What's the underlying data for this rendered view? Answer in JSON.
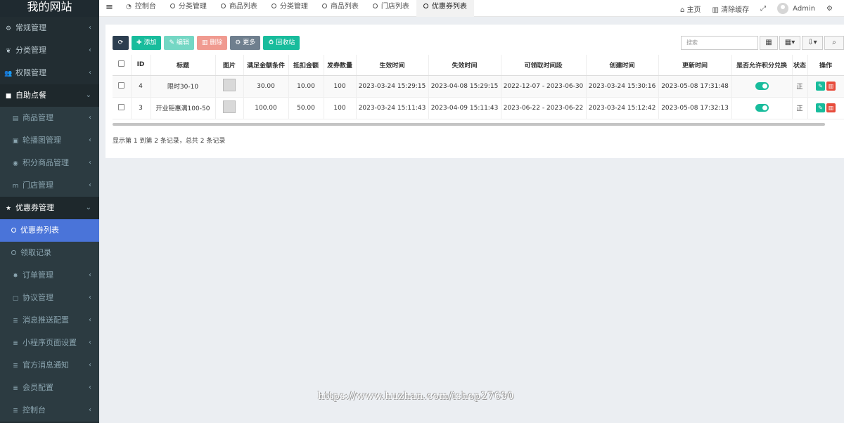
{
  "sidebar": {
    "logo": "我的网站",
    "items": [
      {
        "label": "常规管理",
        "icon": "cogs-icon",
        "glyph": "⚙",
        "type": "group"
      },
      {
        "label": "分类管理",
        "icon": "leaf-icon",
        "glyph": "❦",
        "type": "top"
      },
      {
        "label": "权限管理",
        "icon": "group-icon",
        "glyph": "👥",
        "type": "group"
      },
      {
        "label": "自助点餐",
        "icon": "cutlery-icon",
        "glyph": "■",
        "type": "open"
      },
      {
        "label": "商品管理",
        "icon": "goods-icon",
        "glyph": "▤",
        "type": "sub"
      },
      {
        "label": "轮播图管理",
        "icon": "image-icon",
        "glyph": "▣",
        "type": "sub"
      },
      {
        "label": "积分商品管理",
        "icon": "points-icon",
        "glyph": "◉",
        "type": "sub"
      },
      {
        "label": "门店管理",
        "icon": "store-icon",
        "glyph": "m",
        "type": "sub"
      },
      {
        "label": "优惠券管理",
        "icon": "star-icon",
        "glyph": "★",
        "type": "open-group"
      },
      {
        "label": "优惠券列表",
        "icon": "circle-icon",
        "glyph": "",
        "type": "active"
      },
      {
        "label": "领取记录",
        "icon": "circle-icon",
        "glyph": "",
        "type": "leaf"
      },
      {
        "label": "订单管理",
        "icon": "gear-icon",
        "glyph": "✸",
        "type": "sub"
      },
      {
        "label": "协议管理",
        "icon": "file-icon",
        "glyph": "▢",
        "type": "sub"
      },
      {
        "label": "消息推送配置",
        "icon": "list-icon",
        "glyph": "≣",
        "type": "sub"
      },
      {
        "label": "小程序页面设置",
        "icon": "list-icon",
        "glyph": "≣",
        "type": "sub"
      },
      {
        "label": "官方消息通知",
        "icon": "list-icon",
        "glyph": "≣",
        "type": "sub"
      },
      {
        "label": "会员配置",
        "icon": "list-icon",
        "glyph": "≣",
        "type": "sub"
      },
      {
        "label": "控制台",
        "icon": "list-icon",
        "glyph": "≣",
        "type": "sub"
      }
    ]
  },
  "topbar": {
    "tabs": [
      {
        "label": "控制台",
        "icon": "dashboard-icon",
        "active": false
      },
      {
        "label": "分类管理",
        "icon": "circle-icon",
        "active": false
      },
      {
        "label": "商品列表",
        "icon": "circle-icon",
        "active": false
      },
      {
        "label": "分类管理",
        "icon": "circle-icon",
        "active": false
      },
      {
        "label": "商品列表",
        "icon": "circle-icon",
        "active": false
      },
      {
        "label": "门店列表",
        "icon": "circle-icon",
        "active": false
      },
      {
        "label": "优惠券列表",
        "icon": "circle-icon",
        "active": true
      }
    ],
    "home": "主页",
    "clear_cache": "清除缓存",
    "admin": "Admin"
  },
  "toolbar": {
    "add": "添加",
    "edit": "编辑",
    "delete": "删除",
    "more": "更多",
    "recycle": "回收站",
    "search_placeholder": "搜索"
  },
  "table": {
    "headers": [
      "ID",
      "标题",
      "图片",
      "满足金额条件",
      "抵扣金额",
      "发券数量",
      "生效时间",
      "失效时间",
      "可领取时间段",
      "创建时间",
      "更新时间",
      "是否允许积分兑换",
      "状态",
      "操作"
    ],
    "rows": [
      {
        "id": "4",
        "title": "限时30-10",
        "threshold": "30.00",
        "discount": "10.00",
        "count": "100",
        "start": "2023-03-24 15:29:15",
        "end": "2023-04-08 15:29:15",
        "period": "2022-12-07 - 2023-06-30",
        "created": "2023-03-24 15:30:16",
        "updated": "2023-05-08 17:31:48",
        "points_exchange": true,
        "status": "正"
      },
      {
        "id": "3",
        "title": "开业钜惠满100-50",
        "threshold": "100.00",
        "discount": "50.00",
        "count": "100",
        "start": "2023-03-24 15:11:43",
        "end": "2023-04-09 15:11:43",
        "period": "2023-06-22 - 2023-06-22",
        "created": "2023-03-24 15:12:42",
        "updated": "2023-05-08 17:32:13",
        "points_exchange": true,
        "status": "正"
      }
    ]
  },
  "pager": {
    "summary": "显示第 1 到第 2 条记录，总共 2 条记录"
  },
  "watermark": "https://www.huzhan.com/ishop27690",
  "colors": {
    "sidebar_bg": "#222d32",
    "active_menu": "#4a74d9",
    "success": "#18bc9c",
    "danger": "#e74c3c"
  }
}
